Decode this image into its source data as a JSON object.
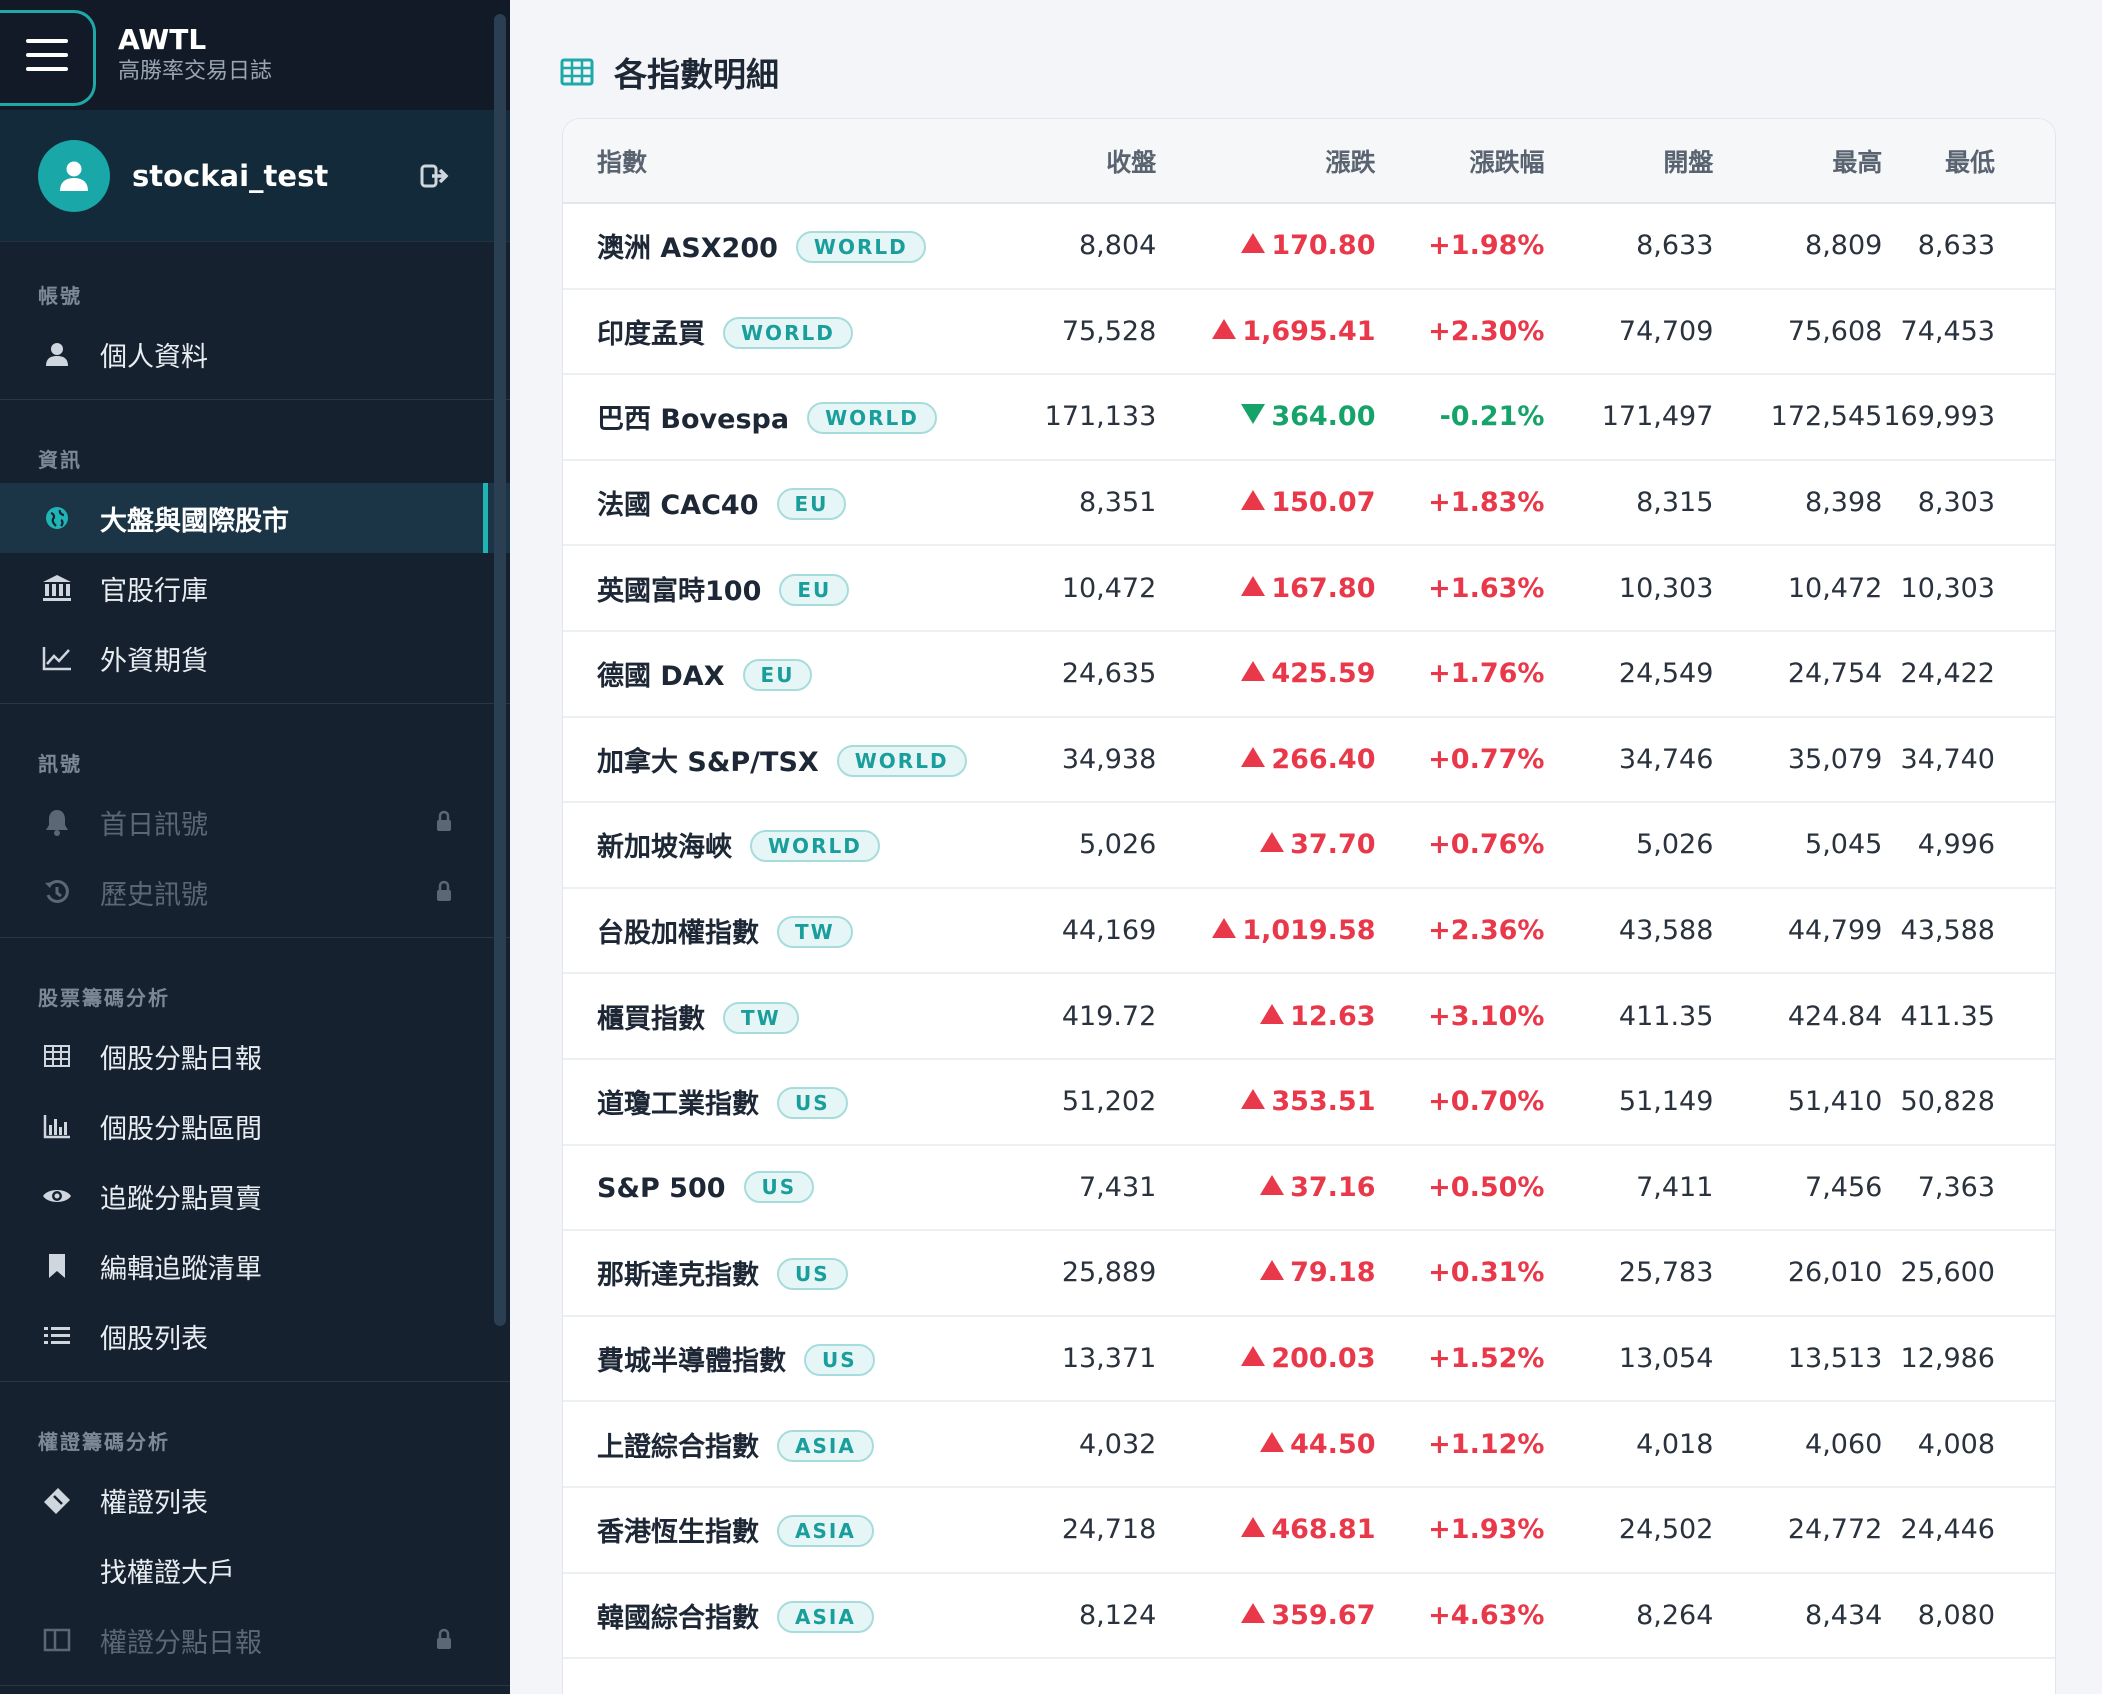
{
  "app": {
    "brand_title": "AWTL",
    "brand_subtitle": "高勝率交易日誌",
    "username": "stockai_test"
  },
  "sidebar": {
    "sections": [
      {
        "label": "帳號",
        "items": [
          {
            "label": "個人資料",
            "icon": "user-icon",
            "state": "normal"
          }
        ]
      },
      {
        "label": "資訊",
        "items": [
          {
            "label": "大盤與國際股市",
            "icon": "globe-icon",
            "state": "active"
          },
          {
            "label": "官股行庫",
            "icon": "bank-icon",
            "state": "normal"
          },
          {
            "label": "外資期貨",
            "icon": "line-chart-icon",
            "state": "normal"
          }
        ]
      },
      {
        "label": "訊號",
        "items": [
          {
            "label": "首日訊號",
            "icon": "bell-icon",
            "state": "locked"
          },
          {
            "label": "歷史訊號",
            "icon": "history-icon",
            "state": "locked"
          }
        ]
      },
      {
        "label": "股票籌碼分析",
        "items": [
          {
            "label": "個股分點日報",
            "icon": "table-icon",
            "state": "normal"
          },
          {
            "label": "個股分點區間",
            "icon": "bar-chart-icon",
            "state": "normal"
          },
          {
            "label": "追蹤分點買賣",
            "icon": "eye-icon",
            "state": "normal"
          },
          {
            "label": "編輯追蹤清單",
            "icon": "bookmark-icon",
            "state": "normal"
          },
          {
            "label": "個股列表",
            "icon": "list-icon",
            "state": "normal"
          }
        ]
      },
      {
        "label": "權證籌碼分析",
        "items": [
          {
            "label": "權證列表",
            "icon": "ticket-icon",
            "state": "normal"
          },
          {
            "label": "找權證大戶",
            "icon": "",
            "state": "normal"
          },
          {
            "label": "權證分點日報",
            "icon": "columns-icon",
            "state": "locked"
          }
        ]
      }
    ]
  },
  "main": {
    "title": "各指數明細",
    "title_icon": "table-icon",
    "columns": [
      "指數",
      "收盤",
      "漲跌",
      "漲跌幅",
      "開盤",
      "最高",
      "最低"
    ],
    "rows": [
      {
        "name": "澳洲 ASX200",
        "tag": "WORLD",
        "close": "8,804",
        "dir": "up",
        "change": "170.80",
        "pct": "+1.98%",
        "open": "8,633",
        "high": "8,809",
        "low": "8,633"
      },
      {
        "name": "印度孟買",
        "tag": "WORLD",
        "close": "75,528",
        "dir": "up",
        "change": "1,695.41",
        "pct": "+2.30%",
        "open": "74,709",
        "high": "75,608",
        "low": "74,453"
      },
      {
        "name": "巴西 Bovespa",
        "tag": "WORLD",
        "close": "171,133",
        "dir": "down",
        "change": "364.00",
        "pct": "-0.21%",
        "open": "171,497",
        "high": "172,545",
        "low": "169,993"
      },
      {
        "name": "法國 CAC40",
        "tag": "EU",
        "close": "8,351",
        "dir": "up",
        "change": "150.07",
        "pct": "+1.83%",
        "open": "8,315",
        "high": "8,398",
        "low": "8,303"
      },
      {
        "name": "英國富時100",
        "tag": "EU",
        "close": "10,472",
        "dir": "up",
        "change": "167.80",
        "pct": "+1.63%",
        "open": "10,303",
        "high": "10,472",
        "low": "10,303"
      },
      {
        "name": "德國 DAX",
        "tag": "EU",
        "close": "24,635",
        "dir": "up",
        "change": "425.59",
        "pct": "+1.76%",
        "open": "24,549",
        "high": "24,754",
        "low": "24,422"
      },
      {
        "name": "加拿大 S&P/TSX",
        "tag": "WORLD",
        "close": "34,938",
        "dir": "up",
        "change": "266.40",
        "pct": "+0.77%",
        "open": "34,746",
        "high": "35,079",
        "low": "34,740"
      },
      {
        "name": "新加坡海峽",
        "tag": "WORLD",
        "close": "5,026",
        "dir": "up",
        "change": "37.70",
        "pct": "+0.76%",
        "open": "5,026",
        "high": "5,045",
        "low": "4,996"
      },
      {
        "name": "台股加權指數",
        "tag": "TW",
        "close": "44,169",
        "dir": "up",
        "change": "1,019.58",
        "pct": "+2.36%",
        "open": "43,588",
        "high": "44,799",
        "low": "43,588"
      },
      {
        "name": "櫃買指數",
        "tag": "TW",
        "close": "419.72",
        "dir": "up",
        "change": "12.63",
        "pct": "+3.10%",
        "open": "411.35",
        "high": "424.84",
        "low": "411.35"
      },
      {
        "name": "道瓊工業指數",
        "tag": "US",
        "close": "51,202",
        "dir": "up",
        "change": "353.51",
        "pct": "+0.70%",
        "open": "51,149",
        "high": "51,410",
        "low": "50,828"
      },
      {
        "name": "S&P 500",
        "tag": "US",
        "close": "7,431",
        "dir": "up",
        "change": "37.16",
        "pct": "+0.50%",
        "open": "7,411",
        "high": "7,456",
        "low": "7,363"
      },
      {
        "name": "那斯達克指數",
        "tag": "US",
        "close": "25,889",
        "dir": "up",
        "change": "79.18",
        "pct": "+0.31%",
        "open": "25,783",
        "high": "26,010",
        "low": "25,600"
      },
      {
        "name": "費城半導體指數",
        "tag": "US",
        "close": "13,371",
        "dir": "up",
        "change": "200.03",
        "pct": "+1.52%",
        "open": "13,054",
        "high": "13,513",
        "low": "12,986"
      },
      {
        "name": "上證綜合指數",
        "tag": "ASIA",
        "close": "4,032",
        "dir": "up",
        "change": "44.50",
        "pct": "+1.12%",
        "open": "4,018",
        "high": "4,060",
        "low": "4,008"
      },
      {
        "name": "香港恆生指數",
        "tag": "ASIA",
        "close": "24,718",
        "dir": "up",
        "change": "468.81",
        "pct": "+1.93%",
        "open": "24,502",
        "high": "24,772",
        "low": "24,446"
      },
      {
        "name": "韓國綜合指數",
        "tag": "ASIA",
        "close": "8,124",
        "dir": "up",
        "change": "359.67",
        "pct": "+4.63%",
        "open": "8,264",
        "high": "8,434",
        "low": "8,080"
      }
    ]
  },
  "colors": {
    "sidebar_bg": "#16212f",
    "accent": "#1fa8a8",
    "up": "#e8384a",
    "down": "#16a36a"
  }
}
